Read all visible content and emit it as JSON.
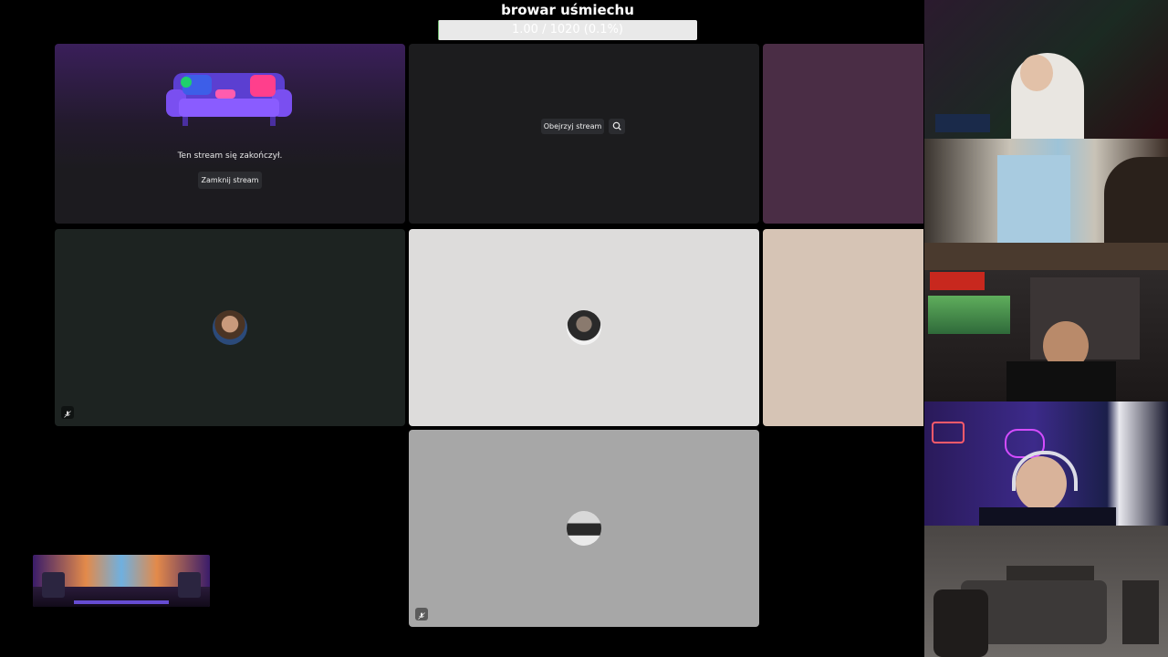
{
  "overlay": {
    "title": "browar uśmiechu",
    "progress_text": "1.00 / 1020 (0.1%)",
    "progress_fraction": 0.001,
    "progress_color": "#6db86d"
  },
  "ended_tile": {
    "message": "Ten stream się zakończył.",
    "close_label": "Zamknij stream"
  },
  "watch_tile": {
    "watch_label": "Obejrzyj stream"
  },
  "colors": {
    "tile_dark": "#1c1c1e",
    "tile_green": "#1d2321",
    "tile_light": "#dddcdb",
    "tile_grey": "#a7a7a7",
    "tile_purple": "#4a2d45",
    "tile_beige": "#d6c4b5"
  },
  "icons": [
    "pop-out-icon",
    "mic-muted-icon",
    "sofa-illustration"
  ]
}
